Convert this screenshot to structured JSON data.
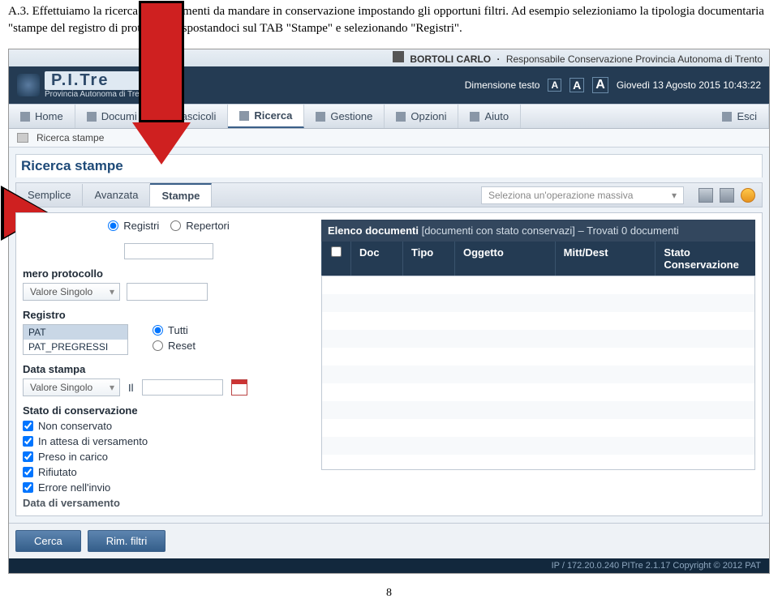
{
  "doc": {
    "para": "A.3. Effettuiamo la ricerca dei documenti da mandare in conservazione impostando gli opportuni filtri. Ad esempio selezioniamo la tipologia documentaria \"stampe del registro di protocollo\", spostandoci sul TAB \"Stampe\" e selezionando \"Registri\".",
    "page_number": "8"
  },
  "header": {
    "user_name": "BORTOLI CARLO",
    "user_role": "Responsabile Conservazione Provincia Autonoma di Trento",
    "logo_sub": "Provincia Autonoma di Trento",
    "logo_main": "P.I.Tre",
    "font_size_label": "Dimensione testo",
    "sizes": [
      "A",
      "A",
      "A"
    ],
    "date_time": "Giovedì 13 Agosto 2015 10:43:22"
  },
  "menu": {
    "items": [
      "Home",
      "Documi",
      "Fascicoli",
      "Ricerca",
      "Gestione",
      "Opzioni",
      "Aiuto"
    ],
    "exit": "Esci"
  },
  "subbar": {
    "crumb": "Ricerca stampe"
  },
  "panel": {
    "title": "Ricerca stampe",
    "tabs": [
      "Semplice",
      "Avanzata",
      "Stampe"
    ],
    "mass_placeholder": "Seleziona un'operazione massiva"
  },
  "left": {
    "type_radios": [
      "Registri",
      "Repertori"
    ],
    "numero_label": "mero protocollo",
    "numero_dd": "Valore Singolo",
    "registro_label": "Registro",
    "registro_options": [
      "PAT",
      "PAT_PREGRESSI"
    ],
    "registro_radios": [
      "Tutti",
      "Reset"
    ],
    "data_stampa_label": "Data stampa",
    "data_stampa_dd": "Valore Singolo",
    "data_stampa_il": "Il",
    "stato_label": "Stato di conservazione",
    "stato_options": [
      "Non conservato",
      "In attesa di versamento",
      "Preso in carico",
      "Rifiutato",
      "Errore nell'invio"
    ],
    "stato_cut": "Data di versamento"
  },
  "right": {
    "docs_head_label": "Elenco documenti",
    "docs_head_detail": "[documenti con stato conservazi] – Trovati 0 documenti",
    "cols": {
      "doc": "Doc",
      "tipo": "Tipo",
      "oggetto": "Oggetto",
      "mittdest": "Mitt/Dest",
      "stato": "Stato Conservazione"
    }
  },
  "buttons": {
    "search": "Cerca",
    "clear": "Rim. filtri"
  },
  "footer": {
    "text": "IP / 172.20.0.240   PITre 2.1.17 Copyright © 2012   PAT"
  }
}
